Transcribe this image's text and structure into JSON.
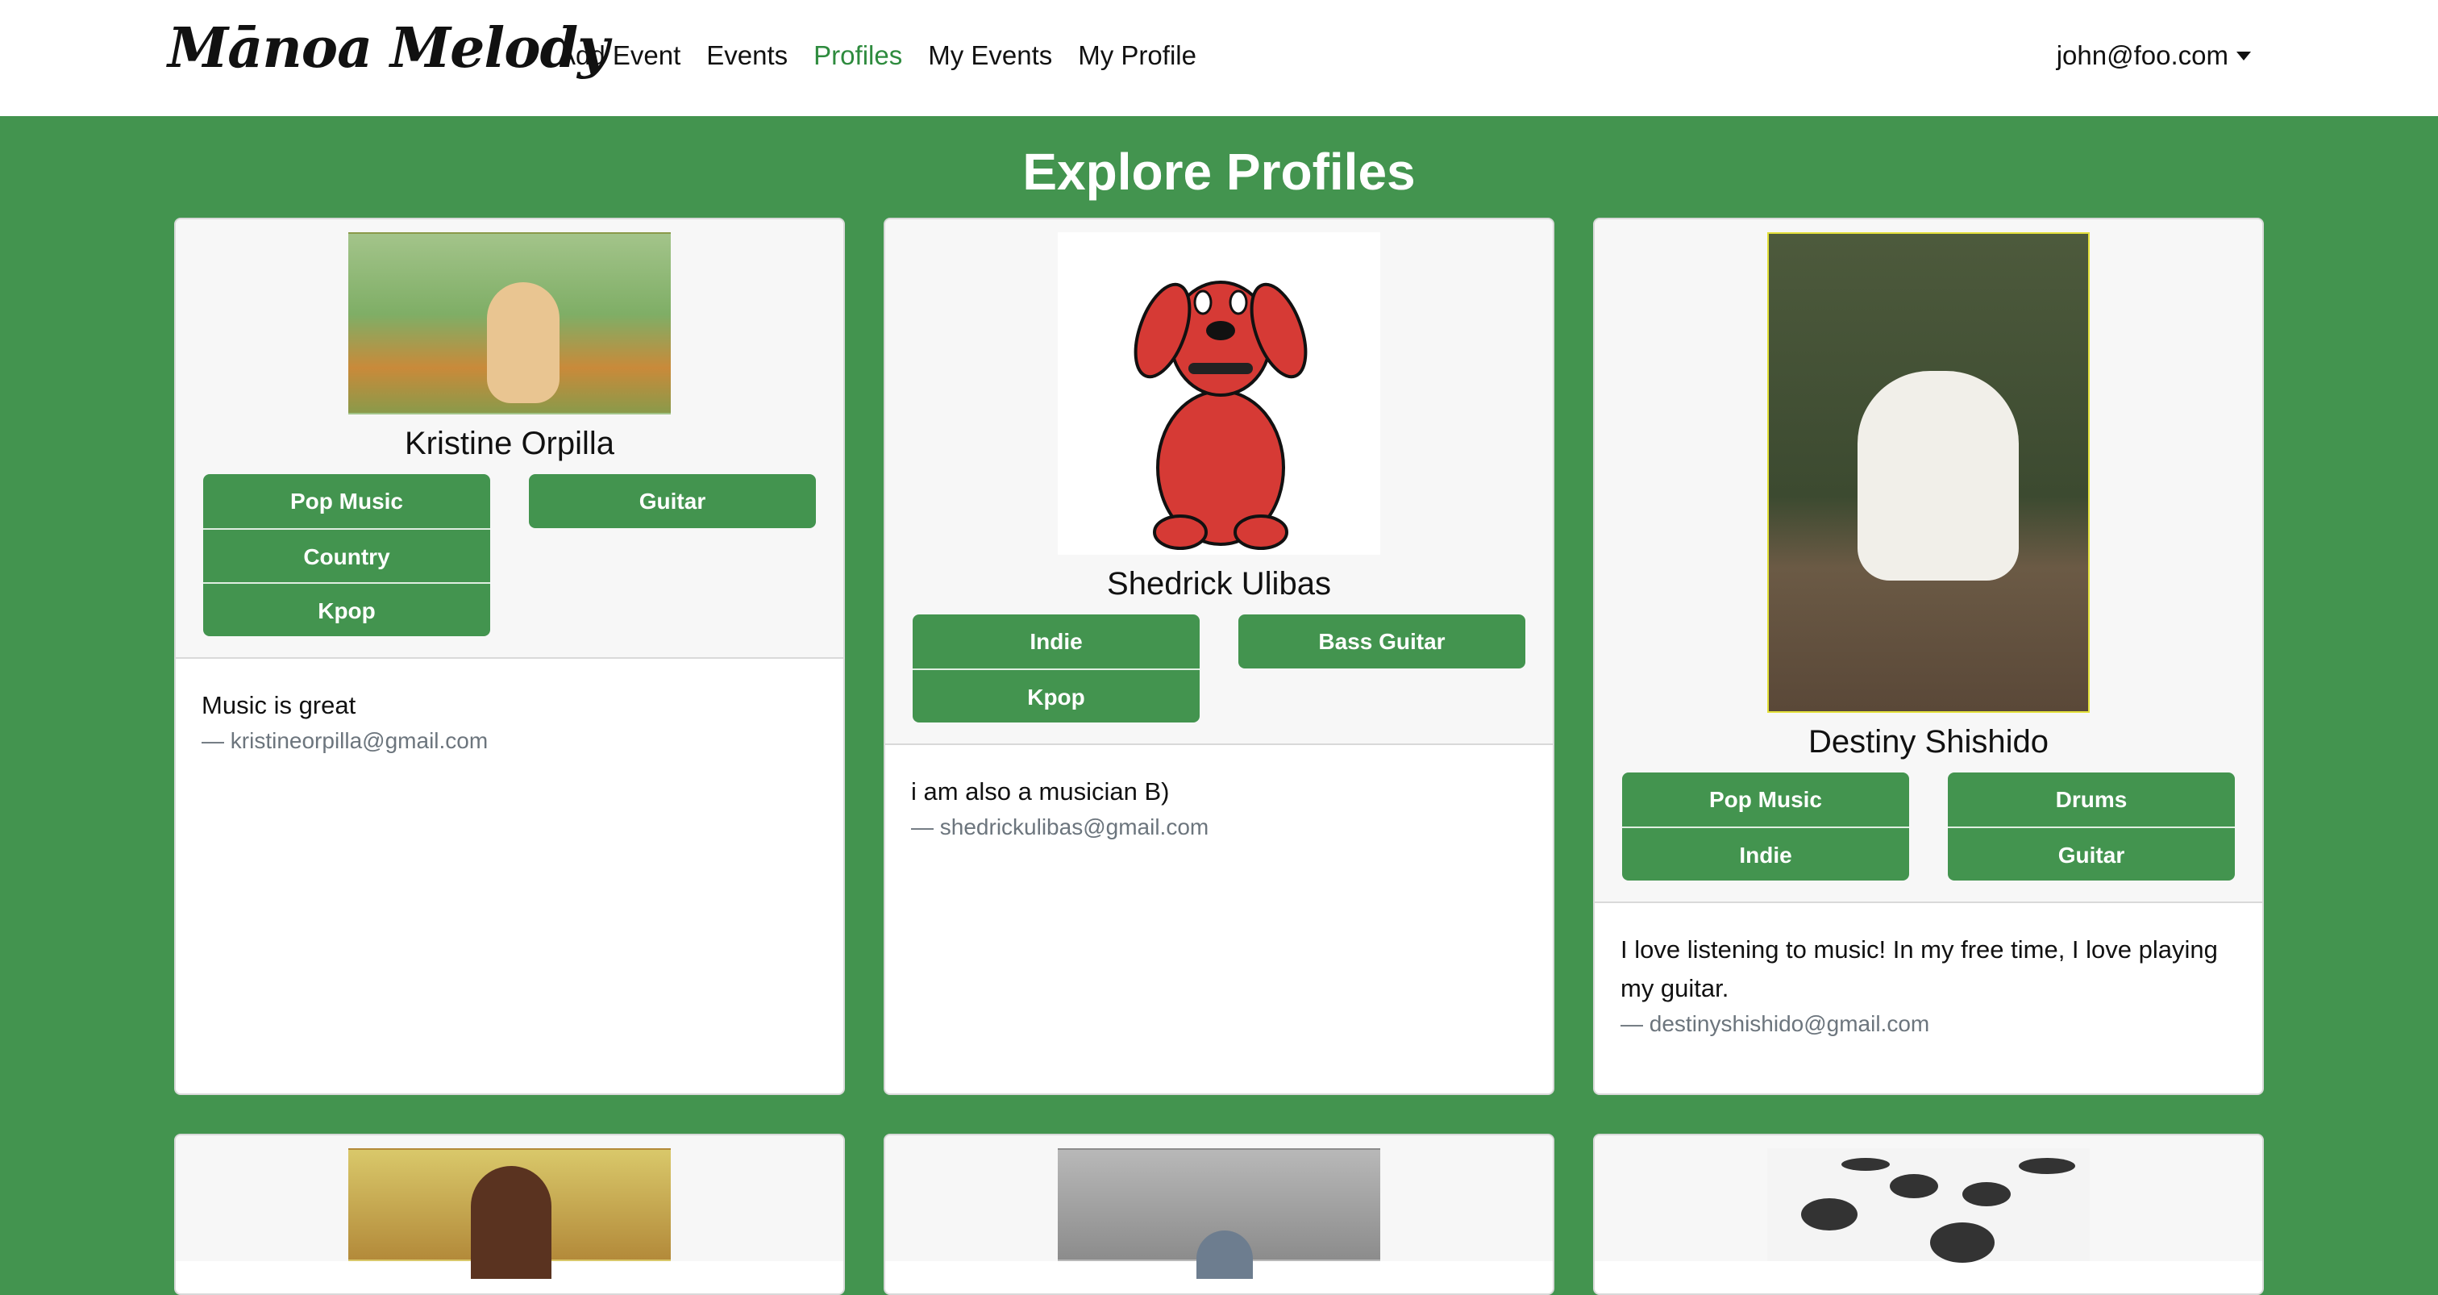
{
  "nav": {
    "brand": "Mānoa Melody",
    "links": [
      "Add Event",
      "Events",
      "Profiles",
      "My Events",
      "My Profile"
    ],
    "active_link": "Profiles",
    "user": "john@foo.com",
    "accent_color": "#2e8b3e"
  },
  "page": {
    "title": "Explore Profiles",
    "background_color": "#43944f"
  },
  "profiles": [
    {
      "name": "Kristine Orpilla",
      "image": "golden-retriever-puppy",
      "genres": [
        "Pop Music",
        "Country",
        "Kpop"
      ],
      "instruments": [
        "Guitar"
      ],
      "bio": "Music is great",
      "email": "— kristineorpilla@gmail.com"
    },
    {
      "name": "Shedrick Ulibas",
      "image": "clifford-big-red-dog",
      "genres": [
        "Indie",
        "Kpop"
      ],
      "instruments": [
        "Bass Guitar"
      ],
      "bio": "i am also a musician B)",
      "email": "— shedrickulibas@gmail.com"
    },
    {
      "name": "Destiny Shishido",
      "image": "white-spotted-dog",
      "genres": [
        "Pop Music",
        "Indie"
      ],
      "instruments": [
        "Drums",
        "Guitar"
      ],
      "bio": "I love listening to music! In my free time, I love playing my guitar.",
      "email": "— destinyshishido@gmail.com"
    },
    {
      "image": "woman-portrait"
    },
    {
      "image": "bernie-mittens"
    },
    {
      "image": "drum-kit"
    }
  ]
}
